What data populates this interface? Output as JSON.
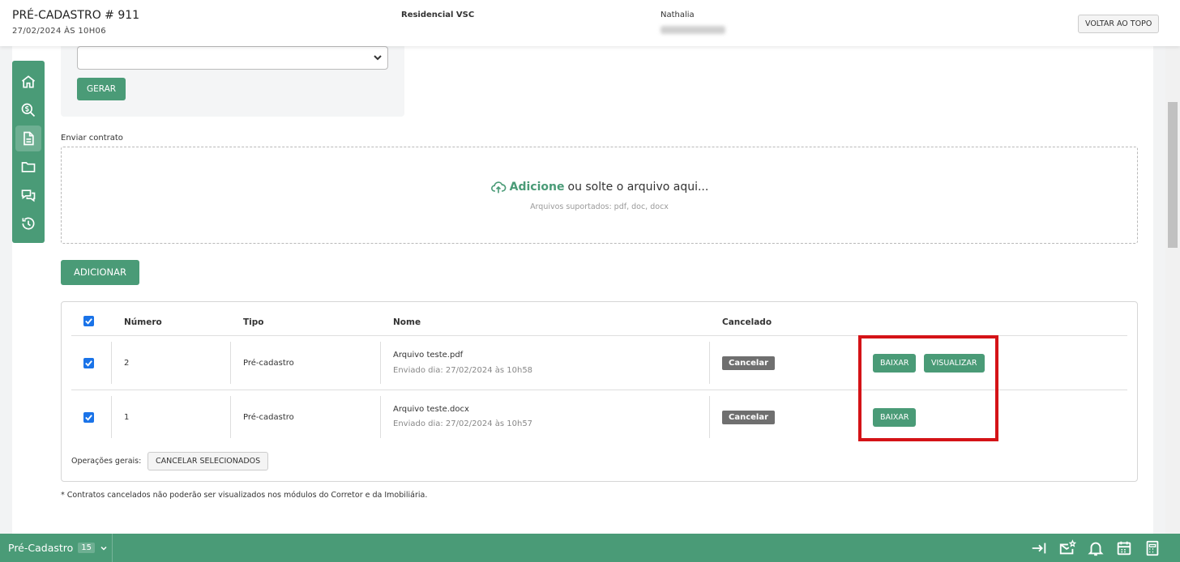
{
  "header": {
    "title": "PRÉ-CADASTRO # 911",
    "subtitle": "27/02/2024 ÀS 10H06",
    "project": "Residencial VSC",
    "client_name": "Nathalia",
    "back_to_top": "VOLTAR AO TOPO"
  },
  "sidebar": {
    "items": [
      {
        "icon": "home-icon"
      },
      {
        "icon": "money-search-icon"
      },
      {
        "icon": "document-icon",
        "active": true
      },
      {
        "icon": "folder-icon"
      },
      {
        "icon": "chat-icon"
      },
      {
        "icon": "history-icon"
      }
    ]
  },
  "generate": {
    "select_value": "",
    "button": "GERAR"
  },
  "upload": {
    "label": "Enviar contrato",
    "add_text": "Adicione",
    "drop_text": "ou solte o arquivo aqui...",
    "hint": "Arquivos suportados: pdf, doc, docx",
    "add_button": "ADICIONAR"
  },
  "table": {
    "headers": {
      "number": "Número",
      "type": "Tipo",
      "name": "Nome",
      "cancelled": "Cancelado"
    },
    "rows": [
      {
        "number": "2",
        "type": "Pré-cadastro",
        "name": "Arquivo teste.pdf",
        "sent": "Enviado dia: 27/02/2024 às 10h58",
        "cancel": "Cancelar",
        "download": "BAIXAR",
        "view": "VISUALIZAR"
      },
      {
        "number": "1",
        "type": "Pré-cadastro",
        "name": "Arquivo teste.docx",
        "sent": "Enviado dia: 27/02/2024 às 10h57",
        "cancel": "Cancelar",
        "download": "BAIXAR"
      }
    ],
    "ops_label": "Operações gerais:",
    "ops_button": "CANCELAR SELECIONADOS"
  },
  "footnote": "* Contratos cancelados não poderão ser visualizados nos módulos do Corretor e da Imobiliária.",
  "bottombar": {
    "tab_label": "Pré-Cadastro",
    "tab_count": "15",
    "icons": [
      "collapse-right-icon",
      "mail-star-icon",
      "bell-icon",
      "calendar-icon",
      "calculator-icon"
    ]
  },
  "colors": {
    "accent": "#4a9b77",
    "highlight": "#d41317",
    "checkbox": "#1a73e8"
  }
}
